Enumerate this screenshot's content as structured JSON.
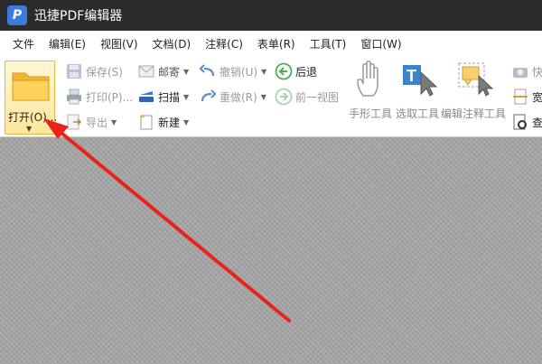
{
  "app": {
    "title": "迅捷PDF编辑器",
    "logo_letter": "P"
  },
  "menu": [
    "文件",
    "编辑(E)",
    "视图(V)",
    "文档(D)",
    "注释(C)",
    "表单(R)",
    "工具(T)",
    "窗口(W)"
  ],
  "toolbar": {
    "open": "打开(O)...",
    "save": "保存(S)",
    "print": "打印(P)...",
    "export": "导出",
    "email": "邮寄",
    "scan": "扫描",
    "new": "新建",
    "undo": "撤销(U)",
    "redo": "重做(R)",
    "back": "后退",
    "prev_view": "前一视图",
    "hand_tool": "手形工具",
    "select_tool": "选取工具",
    "annotate_tool": "编辑注释工具",
    "right_partial": [
      "快",
      "宽",
      "查"
    ]
  },
  "colors": {
    "titlebar": "#2b2b2b",
    "open_button_bg": "#ffe79a",
    "canvas": "#a8a8a8",
    "arrow": "#e8231a"
  }
}
